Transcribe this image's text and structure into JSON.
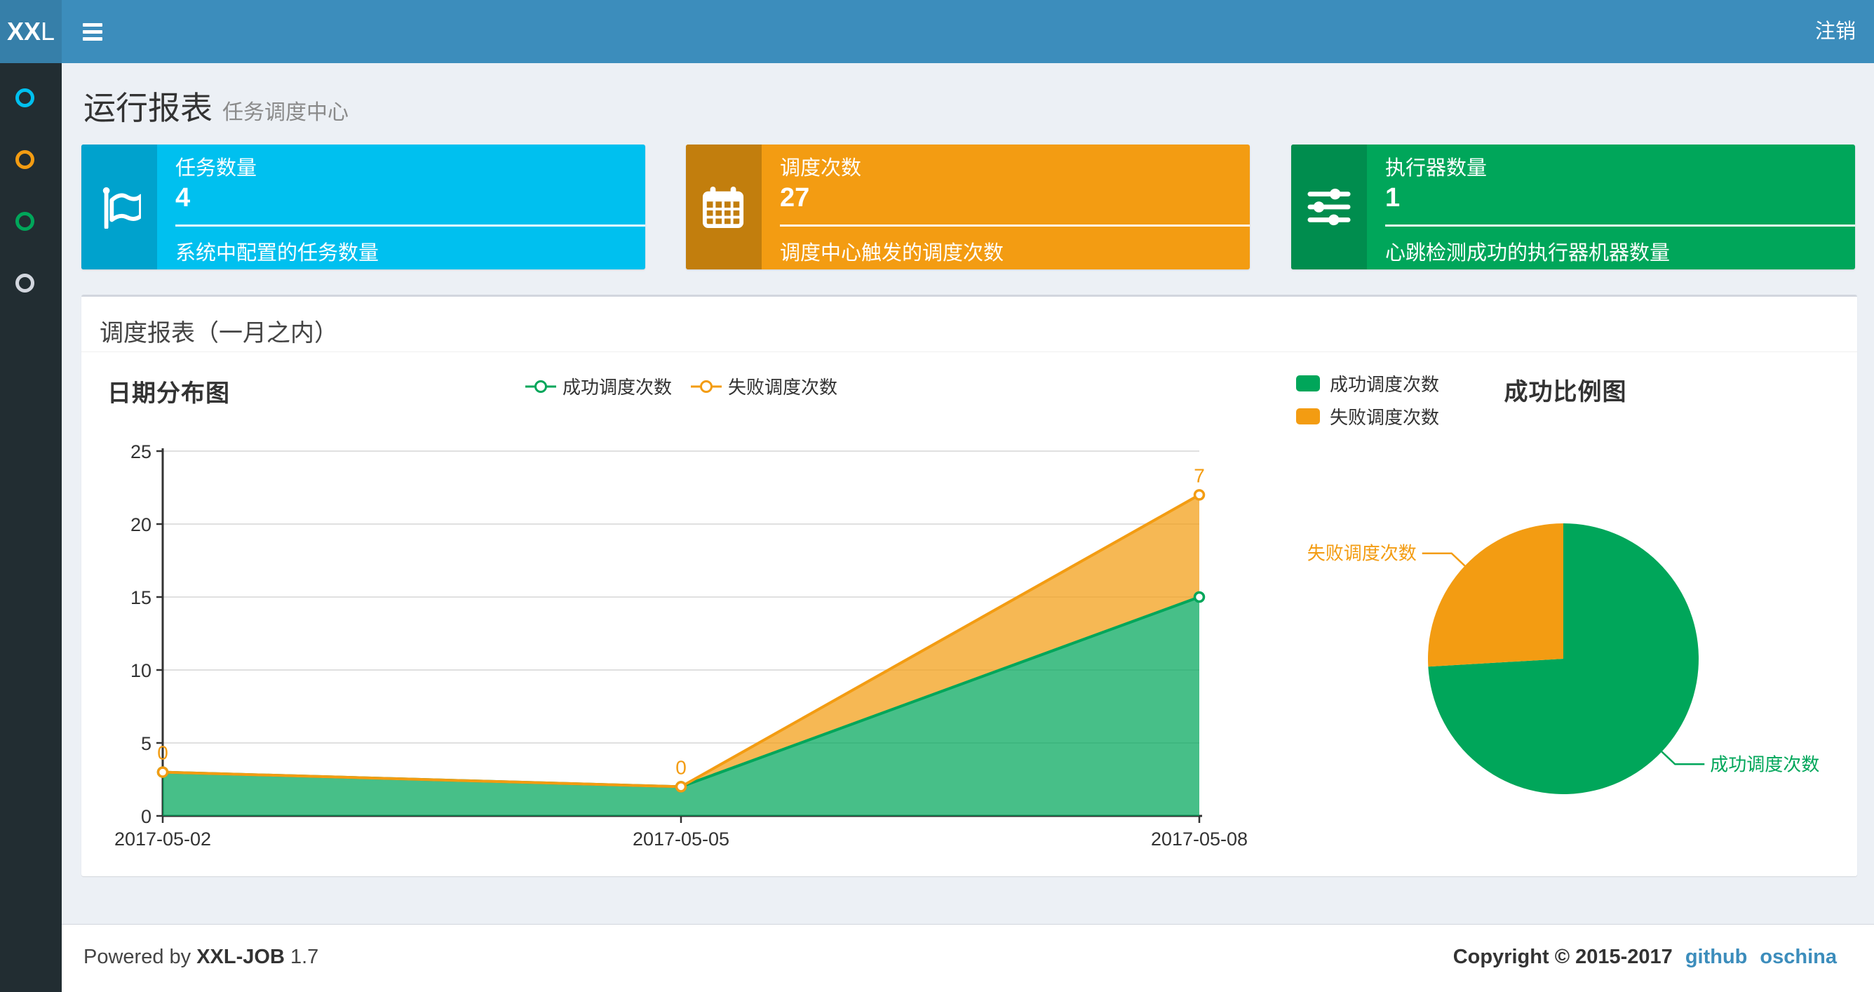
{
  "navbar": {
    "logo_bold": "XX",
    "logo_light": "L",
    "logout_label": "注销"
  },
  "sidebar": {
    "items": [
      {
        "color": "#00c0ef"
      },
      {
        "color": "#f39c12"
      },
      {
        "color": "#00a65a"
      },
      {
        "color": "#d2d6de"
      }
    ]
  },
  "page_header": {
    "title": "运行报表",
    "subtitle": "任务调度中心"
  },
  "info_boxes": [
    {
      "icon": "flag-icon",
      "bg": "#00c0ef",
      "icon_bg": "#00a2cd",
      "title": "任务数量",
      "value": "4",
      "description": "系统中配置的任务数量"
    },
    {
      "icon": "calendar-icon",
      "bg": "#f39c12",
      "icon_bg": "#c27e0d",
      "title": "调度次数",
      "value": "27",
      "description": "调度中心触发的调度次数"
    },
    {
      "icon": "sliders-icon",
      "bg": "#00a65a",
      "icon_bg": "#008d4e",
      "title": "执行器数量",
      "value": "1",
      "description": "心跳检测成功的执行器机器数量"
    }
  ],
  "panel": {
    "title": "调度报表（一月之内）"
  },
  "chart_data": [
    {
      "type": "area",
      "title": "日期分布图",
      "x": [
        "2017-05-02",
        "2017-05-05",
        "2017-05-08"
      ],
      "series": [
        {
          "name": "成功调度次数",
          "values": [
            3,
            2,
            15
          ],
          "color": "#00a65a"
        },
        {
          "name": "失败调度次数",
          "values": [
            0,
            0,
            7
          ],
          "color": "#f39c12",
          "show_labels": true
        }
      ],
      "stacked": true,
      "ylim": [
        0,
        25
      ],
      "yticks": [
        0,
        5,
        10,
        15,
        20,
        25
      ],
      "grid": true,
      "legend_position": "top-center"
    },
    {
      "type": "pie",
      "title": "成功比例图",
      "slices": [
        {
          "name": "成功调度次数",
          "value": 20,
          "color": "#00a65a"
        },
        {
          "name": "失败调度次数",
          "value": 7,
          "color": "#f39c12"
        }
      ],
      "legend_position": "top-left"
    }
  ],
  "footer": {
    "powered_prefix": "Powered by ",
    "brand": "XXL-JOB",
    "version": " 1.7",
    "copyright": "Copyright © 2015-2017",
    "links": [
      {
        "label": "github"
      },
      {
        "label": "oschina"
      }
    ]
  },
  "colors": {
    "navbar": "#3c8dbc",
    "logo_bg": "#367fa9",
    "sidebar_bg": "#222d32",
    "content_bg": "#ecf0f5",
    "success": "#00a65a",
    "fail": "#f39c12",
    "link": "#3c8dbc"
  }
}
